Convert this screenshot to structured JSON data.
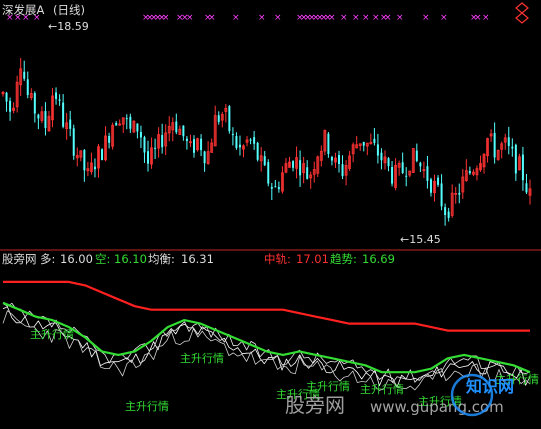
{
  "colors": {
    "up": "#ff3333",
    "down": "#54ffff",
    "marker": "#ff40ff",
    "label": "#dddddd",
    "divider": "#9a1f1f",
    "red_line": "#ff2020",
    "green_line": "#33dd33",
    "white_line": "#ffffff",
    "annotation": "#33dd33",
    "watermark": "#b0b0b0",
    "logo_blue": "#1e90ff"
  },
  "main_panel": {
    "title": "深发展A",
    "period": "(日线)",
    "high_label": "18.59",
    "low_label": "15.45",
    "top_right_icon": "diamond-icon"
  },
  "indicator": {
    "name": "股旁网",
    "duo_label": "多:",
    "duo_value": "16.00",
    "kong_label": "空:",
    "kong_value": "16.10",
    "junheng_label": "均衡:",
    "junheng_value": "16.31",
    "zhongzhou_label": "中轨:",
    "zhongzhou_value": "17.01",
    "qushi_label": "趋势:",
    "qushi_value": "16.69",
    "annotations": [
      "主升行情",
      "主升行情",
      "主升行情",
      "主升行情",
      "主升行情",
      "主升行情",
      "主升行情",
      "主升行情"
    ]
  },
  "watermark": {
    "text1": "股旁网",
    "text2": "www.gupang.com",
    "logo_text": "知识网"
  },
  "chart_data": [
    {
      "type": "candlestick",
      "panel": "price",
      "high": 18.59,
      "low": 15.45,
      "closes_approx": [
        17.6,
        17.3,
        18.2,
        17.5,
        17.3,
        17.1,
        17.7,
        17.2,
        16.9,
        16.6,
        16.3,
        16.6,
        16.8,
        17.2,
        17.3,
        17.0,
        17.1,
        16.5,
        16.7,
        17.0,
        17.2,
        17.0,
        16.7,
        16.9,
        16.6,
        17.2,
        17.3,
        16.9,
        16.7,
        16.9,
        16.6,
        16.3,
        16.1,
        16.4,
        16.6,
        16.5,
        16.3,
        16.7,
        16.9,
        16.5,
        16.4,
        16.7,
        16.9,
        16.8,
        16.7,
        16.5,
        16.3,
        16.4,
        16.6,
        16.5,
        16.3,
        16.1,
        15.8,
        15.9,
        16.2,
        16.4,
        16.6,
        16.9,
        16.7,
        16.8,
        16.6,
        16.4,
        16.0
      ]
    },
    {
      "type": "line",
      "panel": "indicator",
      "series": [
        {
          "name": "中轨",
          "color": "red",
          "values": [
            17.6,
            17.6,
            17.6,
            17.6,
            17.6,
            17.55,
            17.45,
            17.35,
            17.25,
            17.2,
            17.2,
            17.2,
            17.2,
            17.2,
            17.2,
            17.2,
            17.2,
            17.2,
            17.15,
            17.1,
            17.05,
            17.0,
            17.0,
            17.0,
            17.0,
            17.0,
            16.95,
            16.9,
            16.9,
            16.9,
            16.9,
            16.9,
            16.9
          ]
        },
        {
          "name": "趋势",
          "color": "green",
          "values": [
            17.3,
            17.2,
            17.1,
            17.05,
            16.95,
            16.8,
            16.6,
            16.55,
            16.6,
            16.75,
            16.95,
            17.05,
            17.0,
            16.9,
            16.8,
            16.7,
            16.6,
            16.55,
            16.6,
            16.55,
            16.5,
            16.45,
            16.4,
            16.3,
            16.3,
            16.3,
            16.35,
            16.5,
            16.55,
            16.5,
            16.45,
            16.4,
            16.3
          ]
        }
      ]
    }
  ]
}
